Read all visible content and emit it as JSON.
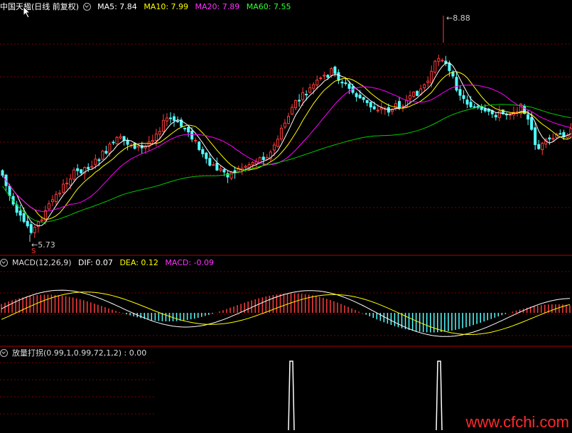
{
  "main_header": {
    "title": "中国天楹(日线 前复权)",
    "ma": [
      {
        "label": "MA5: 7.84",
        "color": "#ffffff"
      },
      {
        "label": "MA10: 7.99",
        "color": "#ffff00"
      },
      {
        "label": "MA20: 7.89",
        "color": "#ff00ff"
      },
      {
        "label": "MA60: 7.55",
        "color": "#00ff00"
      }
    ]
  },
  "price_annotations": {
    "high": "8.88",
    "low": "5.73",
    "marker": "S"
  },
  "macd_header": {
    "name": "MACD(12,26,9)",
    "dif": "DIF: 0.07",
    "dea": "DEA: 0.12",
    "macd": "MACD: -0.09"
  },
  "vol_header": {
    "name": "放量打拐(0.99,1,0.99,72,1,2)",
    "value": ": 0.00"
  },
  "watermark": "www.cfchi.com",
  "colors": {
    "up": "#ff3c3c",
    "down": "#54ffff",
    "divider": "#b00000"
  }
}
